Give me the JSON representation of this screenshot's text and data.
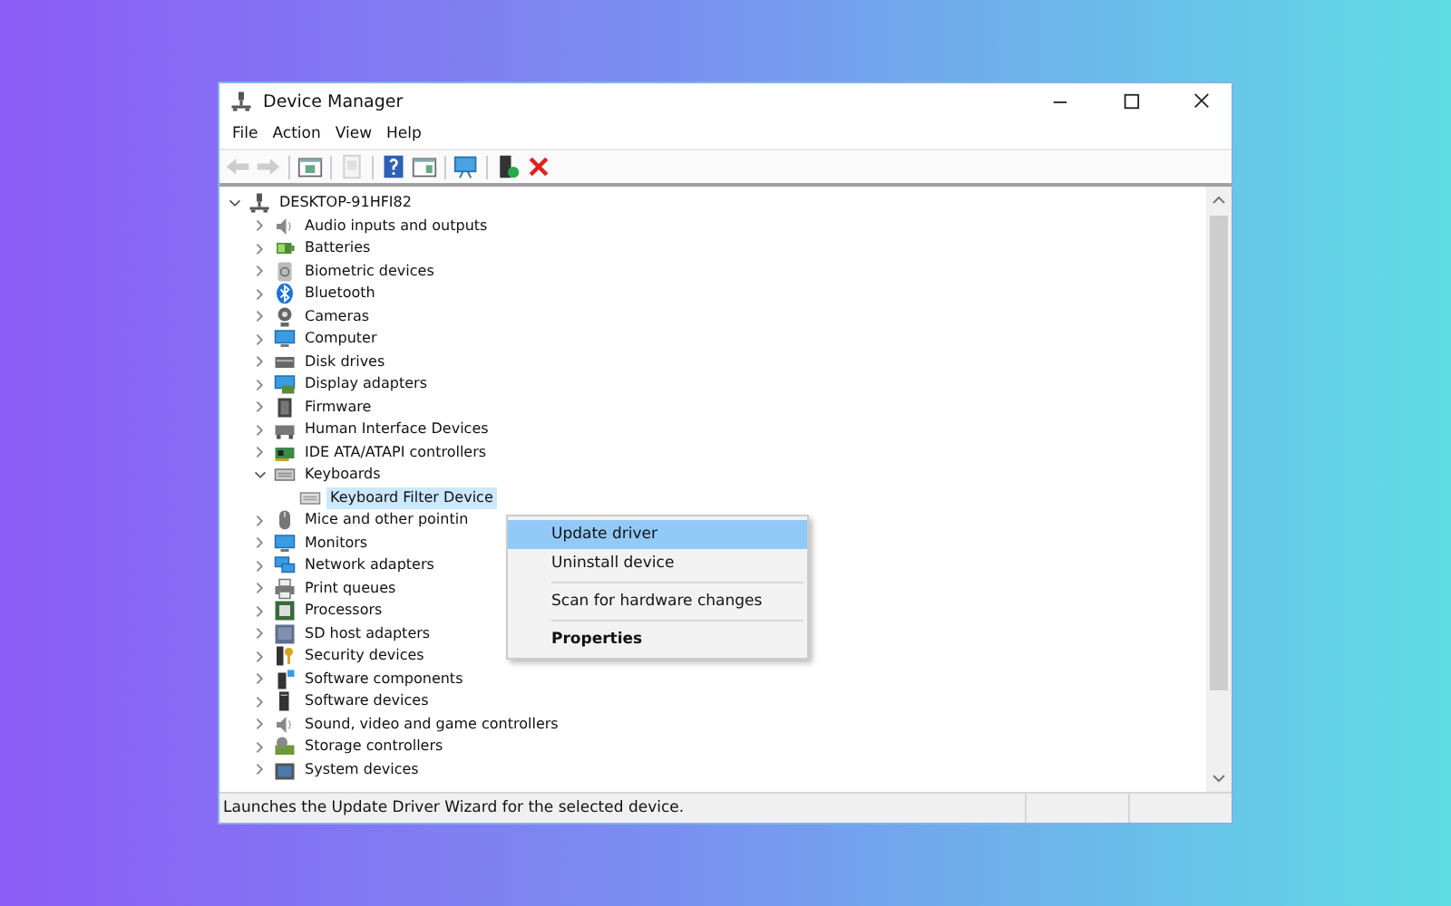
{
  "window": {
    "title": "Device Manager"
  },
  "menu_bar": [
    "File",
    "Action",
    "View",
    "Help"
  ],
  "toolbar": [
    {
      "kind": "back",
      "disabled": true
    },
    {
      "kind": "forward",
      "disabled": true
    },
    {
      "kind": "separator"
    },
    {
      "kind": "show-hide",
      "disabled": false
    },
    {
      "kind": "separator"
    },
    {
      "kind": "properties",
      "disabled": true
    },
    {
      "kind": "separator"
    },
    {
      "kind": "help",
      "disabled": false
    },
    {
      "kind": "view",
      "disabled": false
    },
    {
      "kind": "separator"
    },
    {
      "kind": "monitor",
      "disabled": false
    },
    {
      "kind": "separator"
    },
    {
      "kind": "add-driver",
      "disabled": false
    },
    {
      "kind": "remove",
      "disabled": false
    }
  ],
  "tree": {
    "label": "DESKTOP-91HFI82",
    "expanded": true,
    "selected": false,
    "children": [
      {
        "label": "Audio inputs and outputs",
        "expanded": false,
        "selected": false
      },
      {
        "label": "Batteries",
        "expanded": false,
        "selected": false
      },
      {
        "label": "Biometric devices",
        "expanded": false,
        "selected": false
      },
      {
        "label": "Bluetooth",
        "expanded": false,
        "selected": false
      },
      {
        "label": "Cameras",
        "expanded": false,
        "selected": false
      },
      {
        "label": "Computer",
        "expanded": false,
        "selected": false
      },
      {
        "label": "Disk drives",
        "expanded": false,
        "selected": false
      },
      {
        "label": "Display adapters",
        "expanded": false,
        "selected": false
      },
      {
        "label": "Firmware",
        "expanded": false,
        "selected": false
      },
      {
        "label": "Human Interface Devices",
        "expanded": false,
        "selected": false
      },
      {
        "label": "IDE ATA/ATAPI controllers",
        "expanded": false,
        "selected": false
      },
      {
        "label": "Keyboards",
        "expanded": true,
        "selected": false,
        "children": [
          {
            "label": "Keyboard Filter Device",
            "selected": true
          }
        ]
      },
      {
        "label": "Mice and other pointin",
        "expanded": false,
        "selected": false
      },
      {
        "label": "Monitors",
        "expanded": false,
        "selected": false
      },
      {
        "label": "Network adapters",
        "expanded": false,
        "selected": false
      },
      {
        "label": "Print queues",
        "expanded": false,
        "selected": false
      },
      {
        "label": "Processors",
        "expanded": false,
        "selected": false
      },
      {
        "label": "SD host adapters",
        "expanded": false,
        "selected": false
      },
      {
        "label": "Security devices",
        "expanded": false,
        "selected": false
      },
      {
        "label": "Software components",
        "expanded": false,
        "selected": false
      },
      {
        "label": "Software devices",
        "expanded": false,
        "selected": false
      },
      {
        "label": "Sound, video and game controllers",
        "expanded": false,
        "selected": false
      },
      {
        "label": "Storage controllers",
        "expanded": false,
        "selected": false
      },
      {
        "label": "System devices",
        "expanded": false,
        "selected": false
      }
    ]
  },
  "context_menu": [
    {
      "kind": "item",
      "label": "Update driver",
      "selected": true,
      "bold": false
    },
    {
      "kind": "item",
      "label": "Uninstall device",
      "selected": false,
      "bold": false
    },
    {
      "kind": "separator"
    },
    {
      "kind": "item",
      "label": "Scan for hardware changes",
      "selected": false,
      "bold": false
    },
    {
      "kind": "separator"
    },
    {
      "kind": "item",
      "label": "Properties",
      "selected": false,
      "bold": true
    }
  ],
  "status_bar": "Launches the Update Driver Wizard for the selected device."
}
